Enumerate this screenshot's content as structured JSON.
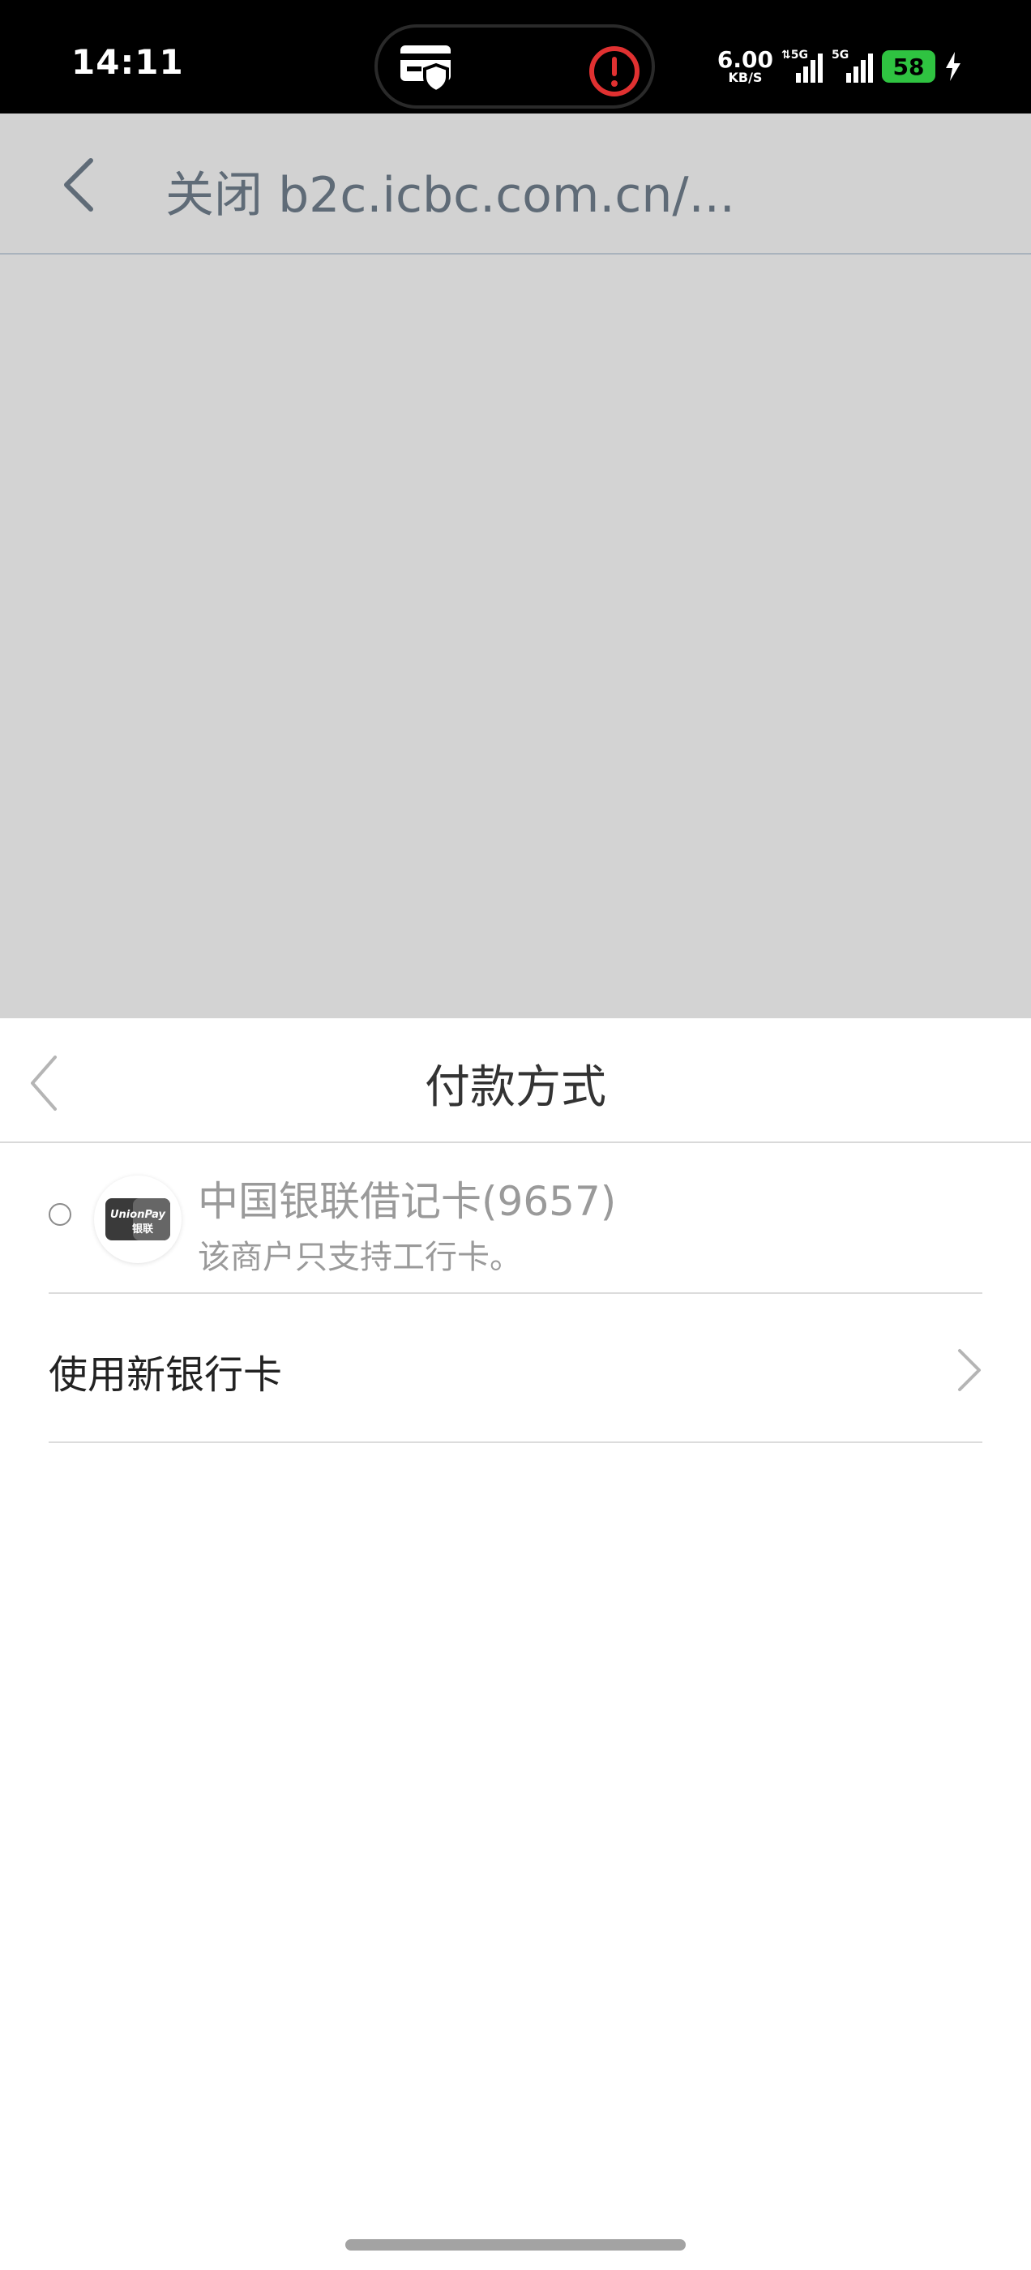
{
  "status_bar": {
    "time": "14:11",
    "net_speed_value": "6.00",
    "net_speed_unit": "KB/S",
    "sim1_label": "5G",
    "sim2_label": "5G",
    "battery_level": "58"
  },
  "top_bar": {
    "title": "关闭 b2c.icbc.com.cn/..."
  },
  "payment_sheet": {
    "title": "付款方式",
    "card": {
      "name": "中国银联借记卡(9657)",
      "note": "该商户只支持工行卡。",
      "logo_text_top": "UnionPay",
      "logo_text_bottom": "银联",
      "selected": false
    },
    "new_card_label": "使用新银行卡"
  },
  "colors": {
    "overlay": "#d3d3d3",
    "battery": "#2fc341",
    "alert": "#e03131"
  }
}
